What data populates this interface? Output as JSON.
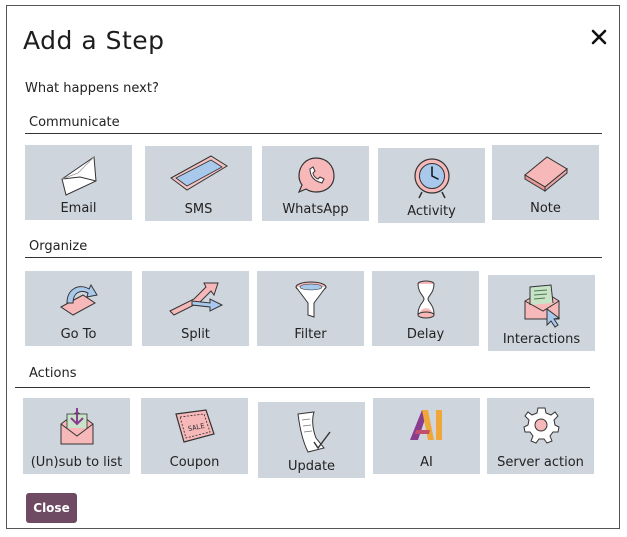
{
  "dialog": {
    "title": "Add a Step",
    "subtitle": "What happens next?",
    "close_button": "Close"
  },
  "sections": [
    {
      "label": "Communicate",
      "tiles": [
        {
          "label": "Email",
          "icon": "envelope-icon"
        },
        {
          "label": "SMS",
          "icon": "phone-icon"
        },
        {
          "label": "WhatsApp",
          "icon": "whatsapp-icon"
        },
        {
          "label": "Activity",
          "icon": "clock-icon"
        },
        {
          "label": "Note",
          "icon": "note-icon"
        }
      ]
    },
    {
      "label": "Organize",
      "tiles": [
        {
          "label": "Go To",
          "icon": "goto-arrow-icon"
        },
        {
          "label": "Split",
          "icon": "split-arrow-icon"
        },
        {
          "label": "Filter",
          "icon": "funnel-icon"
        },
        {
          "label": "Delay",
          "icon": "hourglass-icon"
        },
        {
          "label": "Interactions",
          "icon": "envelope-cursor-icon"
        }
      ]
    },
    {
      "label": "Actions",
      "tiles": [
        {
          "label": "(Un)sub to list",
          "icon": "envelope-badge-icon"
        },
        {
          "label": "Coupon",
          "icon": "coupon-icon"
        },
        {
          "label": "Update",
          "icon": "document-check-icon"
        },
        {
          "label": "AI",
          "icon": "ai-logo-icon"
        },
        {
          "label": "Server action",
          "icon": "gear-icon"
        }
      ]
    }
  ],
  "colors": {
    "tile_bg": "#cfd5dd",
    "close_button_bg": "#6e4a63",
    "icon_pink": "#f6b8b8",
    "icon_blue": "#a9c9ec",
    "ai_orange": "#f0a73a",
    "ai_purple": "#8a3c8f"
  }
}
